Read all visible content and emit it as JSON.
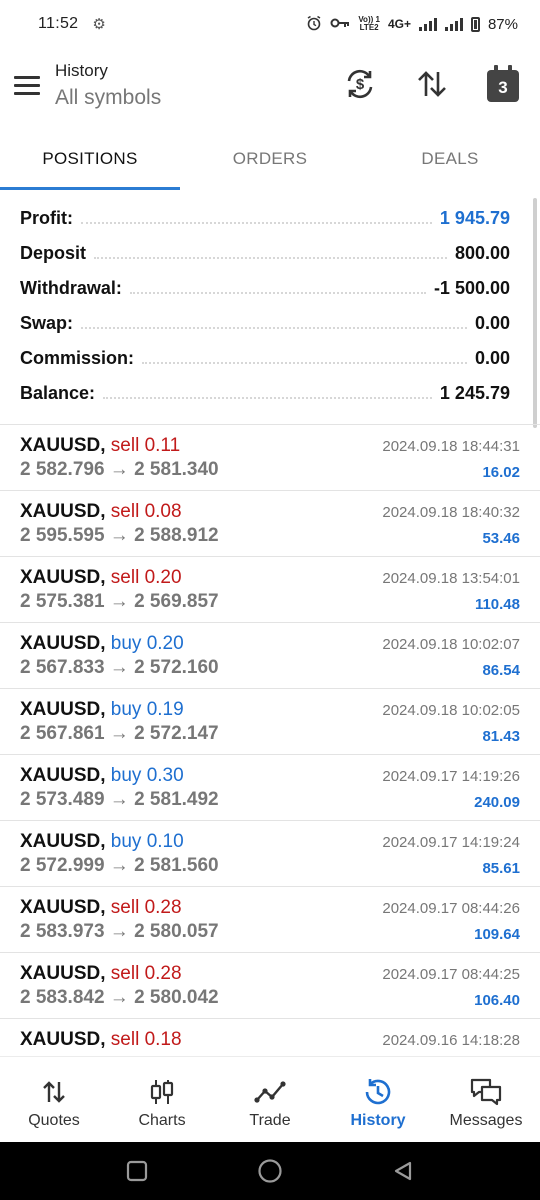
{
  "status_bar": {
    "time": "11:52",
    "network_top": "Vo)) 1",
    "network_bottom": "LTE2",
    "network_type": "4G+",
    "battery": "87%"
  },
  "header": {
    "title": "History",
    "subtitle": "All symbols",
    "calendar_day": "3",
    "icons": [
      "dollar-refresh-icon",
      "sort-arrows-icon",
      "calendar-icon",
      "menu-icon"
    ]
  },
  "tabs": [
    {
      "label": "POSITIONS",
      "active": true
    },
    {
      "label": "ORDERS",
      "active": false
    },
    {
      "label": "DEALS",
      "active": false
    }
  ],
  "summary": [
    {
      "label": "Profit:",
      "value": "1 945.79",
      "highlight": true
    },
    {
      "label": "Deposit",
      "value": "800.00",
      "highlight": false
    },
    {
      "label": "Withdrawal:",
      "value": "-1 500.00",
      "highlight": false
    },
    {
      "label": "Swap:",
      "value": "0.00",
      "highlight": false
    },
    {
      "label": "Commission:",
      "value": "0.00",
      "highlight": false
    },
    {
      "label": "Balance:",
      "value": "1 245.79",
      "highlight": false
    }
  ],
  "positions": [
    {
      "symbol": "XAUUSD,",
      "side": "sell 0.11",
      "type": "sell",
      "prices": "2 582.796 → 2 581.340",
      "datetime": "2024.09.18 18:44:31",
      "profit": "16.02"
    },
    {
      "symbol": "XAUUSD,",
      "side": "sell 0.08",
      "type": "sell",
      "prices": "2 595.595 → 2 588.912",
      "datetime": "2024.09.18 18:40:32",
      "profit": "53.46"
    },
    {
      "symbol": "XAUUSD,",
      "side": "sell 0.20",
      "type": "sell",
      "prices": "2 575.381 → 2 569.857",
      "datetime": "2024.09.18 13:54:01",
      "profit": "110.48"
    },
    {
      "symbol": "XAUUSD,",
      "side": "buy 0.20",
      "type": "buy",
      "prices": "2 567.833 → 2 572.160",
      "datetime": "2024.09.18 10:02:07",
      "profit": "86.54"
    },
    {
      "symbol": "XAUUSD,",
      "side": "buy 0.19",
      "type": "buy",
      "prices": "2 567.861 → 2 572.147",
      "datetime": "2024.09.18 10:02:05",
      "profit": "81.43"
    },
    {
      "symbol": "XAUUSD,",
      "side": "buy 0.30",
      "type": "buy",
      "prices": "2 573.489 → 2 581.492",
      "datetime": "2024.09.17 14:19:26",
      "profit": "240.09"
    },
    {
      "symbol": "XAUUSD,",
      "side": "buy 0.10",
      "type": "buy",
      "prices": "2 572.999 → 2 581.560",
      "datetime": "2024.09.17 14:19:24",
      "profit": "85.61"
    },
    {
      "symbol": "XAUUSD,",
      "side": "sell 0.28",
      "type": "sell",
      "prices": "2 583.973 → 2 580.057",
      "datetime": "2024.09.17 08:44:26",
      "profit": "109.64"
    },
    {
      "symbol": "XAUUSD,",
      "side": "sell 0.28",
      "type": "sell",
      "prices": "2 583.842 → 2 580.042",
      "datetime": "2024.09.17 08:44:25",
      "profit": "106.40"
    },
    {
      "symbol": "XAUUSD,",
      "side": "sell 0.18",
      "type": "sell",
      "prices": "",
      "datetime": "2024.09.16 14:18:28",
      "profit": ""
    }
  ],
  "bottom_nav": [
    {
      "label": "Quotes",
      "icon": "quotes-arrows-icon",
      "active": false
    },
    {
      "label": "Charts",
      "icon": "candlestick-icon",
      "active": false
    },
    {
      "label": "Trade",
      "icon": "trend-line-icon",
      "active": false
    },
    {
      "label": "History",
      "icon": "history-clock-icon",
      "active": true
    },
    {
      "label": "Messages",
      "icon": "chat-bubbles-icon",
      "active": false
    }
  ],
  "colors": {
    "accent_blue": "#1e6fd0",
    "tab_indicator": "#2b7cd3",
    "sell_red": "#c11a1a",
    "muted_gray": "#777777"
  }
}
